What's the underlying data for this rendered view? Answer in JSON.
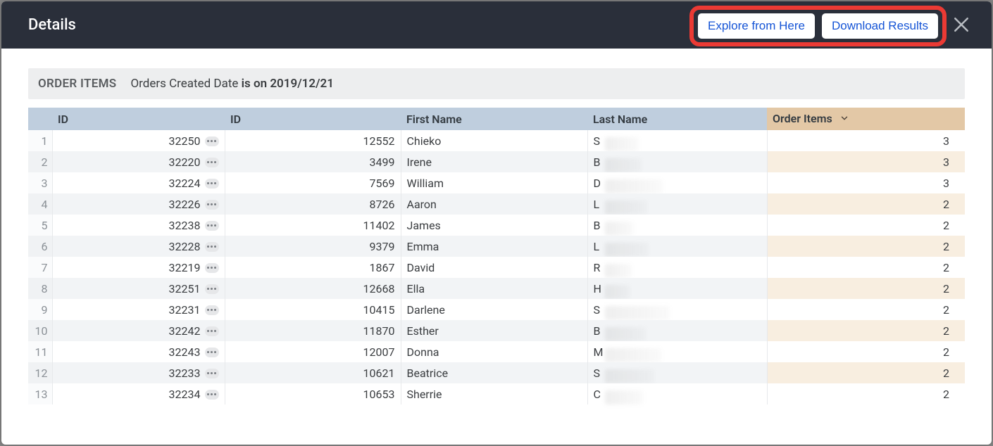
{
  "header": {
    "title": "Details",
    "explore_btn": "Explore from Here",
    "download_btn": "Download Results"
  },
  "filter": {
    "section": "ORDER ITEMS",
    "field": "Orders Created Date",
    "predicate": "is on 2019/12/21"
  },
  "columns": {
    "id1": "ID",
    "id2": "ID",
    "first_name": "First Name",
    "last_name": "Last Name",
    "order_items": "Order Items"
  },
  "rows": [
    {
      "n": 1,
      "id1": "32250",
      "id2": "12552",
      "fn": "Chieko",
      "ln_initial": "S",
      "oi": 3
    },
    {
      "n": 2,
      "id1": "32220",
      "id2": "3499",
      "fn": "Irene",
      "ln_initial": "B",
      "oi": 3
    },
    {
      "n": 3,
      "id1": "32224",
      "id2": "7569",
      "fn": "William",
      "ln_initial": "D",
      "oi": 3
    },
    {
      "n": 4,
      "id1": "32226",
      "id2": "8726",
      "fn": "Aaron",
      "ln_initial": "L",
      "oi": 2
    },
    {
      "n": 5,
      "id1": "32238",
      "id2": "11402",
      "fn": "James",
      "ln_initial": "B",
      "oi": 2
    },
    {
      "n": 6,
      "id1": "32228",
      "id2": "9379",
      "fn": "Emma",
      "ln_initial": "L",
      "oi": 2
    },
    {
      "n": 7,
      "id1": "32219",
      "id2": "1867",
      "fn": "David",
      "ln_initial": "R",
      "oi": 2
    },
    {
      "n": 8,
      "id1": "32251",
      "id2": "12668",
      "fn": "Ella",
      "ln_initial": "H",
      "oi": 2
    },
    {
      "n": 9,
      "id1": "32231",
      "id2": "10415",
      "fn": "Darlene",
      "ln_initial": "S",
      "oi": 2
    },
    {
      "n": 10,
      "id1": "32242",
      "id2": "11870",
      "fn": "Esther",
      "ln_initial": "B",
      "oi": 2
    },
    {
      "n": 11,
      "id1": "32243",
      "id2": "12007",
      "fn": "Donna",
      "ln_initial": "M",
      "oi": 2
    },
    {
      "n": 12,
      "id1": "32233",
      "id2": "10621",
      "fn": "Beatrice",
      "ln_initial": "S",
      "oi": 2
    },
    {
      "n": 13,
      "id1": "32234",
      "id2": "10653",
      "fn": "Sherrie",
      "ln_initial": "C",
      "oi": 2
    }
  ],
  "blur_widths": [
    48,
    52,
    82,
    60,
    40,
    62,
    38,
    36,
    92,
    58,
    80,
    70,
    54
  ]
}
